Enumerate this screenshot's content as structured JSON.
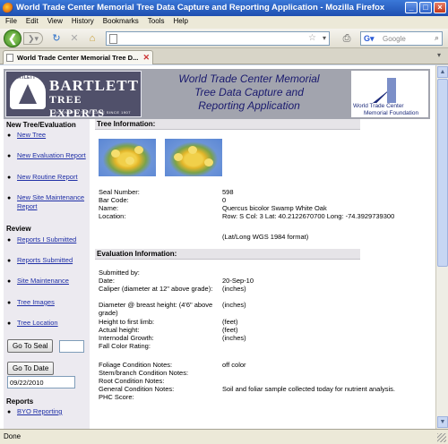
{
  "window": {
    "title": "World Trade Center Memorial Tree Data Capture and Reporting Application - Mozilla Firefox"
  },
  "menu": [
    "File",
    "Edit",
    "View",
    "History",
    "Bookmarks",
    "Tools",
    "Help"
  ],
  "toolbar": {
    "search_placeholder": "Google"
  },
  "tab": {
    "title": "World Trade Center Memorial Tree D..."
  },
  "banner": {
    "logo_name": "BARTLETT",
    "logo_tagline": "TREE EXPERTS",
    "logo_small": "SCIENTIFIC TREE CARE SINCE 1907",
    "title_lines": [
      "World Trade Center Memorial",
      "Tree Data Capture and",
      "Reporting Application"
    ],
    "wtc_line1": "World Trade Center",
    "wtc_line2": "Memorial Foundation"
  },
  "nav": {
    "section1": "New Tree/Evaluation",
    "items1": [
      "New Tree",
      "New Evaluation Report",
      "New Routine Report",
      "New Site Maintenance Report"
    ],
    "section2": "Review",
    "items2": [
      "Reports I Submitted",
      "Reports Submitted",
      "Site Maintenance",
      "Tree Images",
      "Tree Location"
    ],
    "goto_seal_label": "Go To Seal",
    "goto_seal_value": "",
    "goto_date_label": "Go To Date",
    "goto_date_value": "09/22/2010",
    "section3": "Reports",
    "items3": [
      "BYO Reporting"
    ]
  },
  "tree_info": {
    "heading": "Tree Information:",
    "fields": [
      {
        "label": "Seal Number:",
        "value": "598"
      },
      {
        "label": "Bar Code:",
        "value": "0"
      },
      {
        "label": "Name:",
        "value": "Quercus bicolor Swamp White Oak"
      },
      {
        "label": "Location:",
        "value": "Row: S   Col: 3   Lat: 40.2122670700   Long: -74.3929739300"
      }
    ],
    "location_note": "(Lat/Long WGS 1984 format)"
  },
  "evaluation": {
    "heading": "Evaluation Information:",
    "fields": [
      {
        "label": "Submitted by:",
        "value": ""
      },
      {
        "label": "Date:",
        "value": "20-Sep-10"
      },
      {
        "label": "Caliper (diameter at 12\" above grade):",
        "value": "(inches)"
      },
      {
        "label": "Diameter @ breast height: (4'6\" above grade)",
        "value": "(inches)"
      },
      {
        "label": "Height to first limb:",
        "value": "(feet)"
      },
      {
        "label": "Actual height:",
        "value": "(feet)"
      },
      {
        "label": "Internodal Growth:",
        "value": "(inches)"
      },
      {
        "label": "Fall Color Rating:",
        "value": ""
      },
      {
        "label": "Foliage Condition Notes:",
        "value": "off color"
      },
      {
        "label": "Stem/branch Condition Notes:",
        "value": ""
      },
      {
        "label": "Root Condition Notes:",
        "value": ""
      },
      {
        "label": "General Condition Notes:",
        "value": "Soil and foliar sample collected today for nutrient analysis."
      },
      {
        "label": "PHC Score:",
        "value": ""
      }
    ]
  },
  "status": {
    "text": "Done"
  }
}
